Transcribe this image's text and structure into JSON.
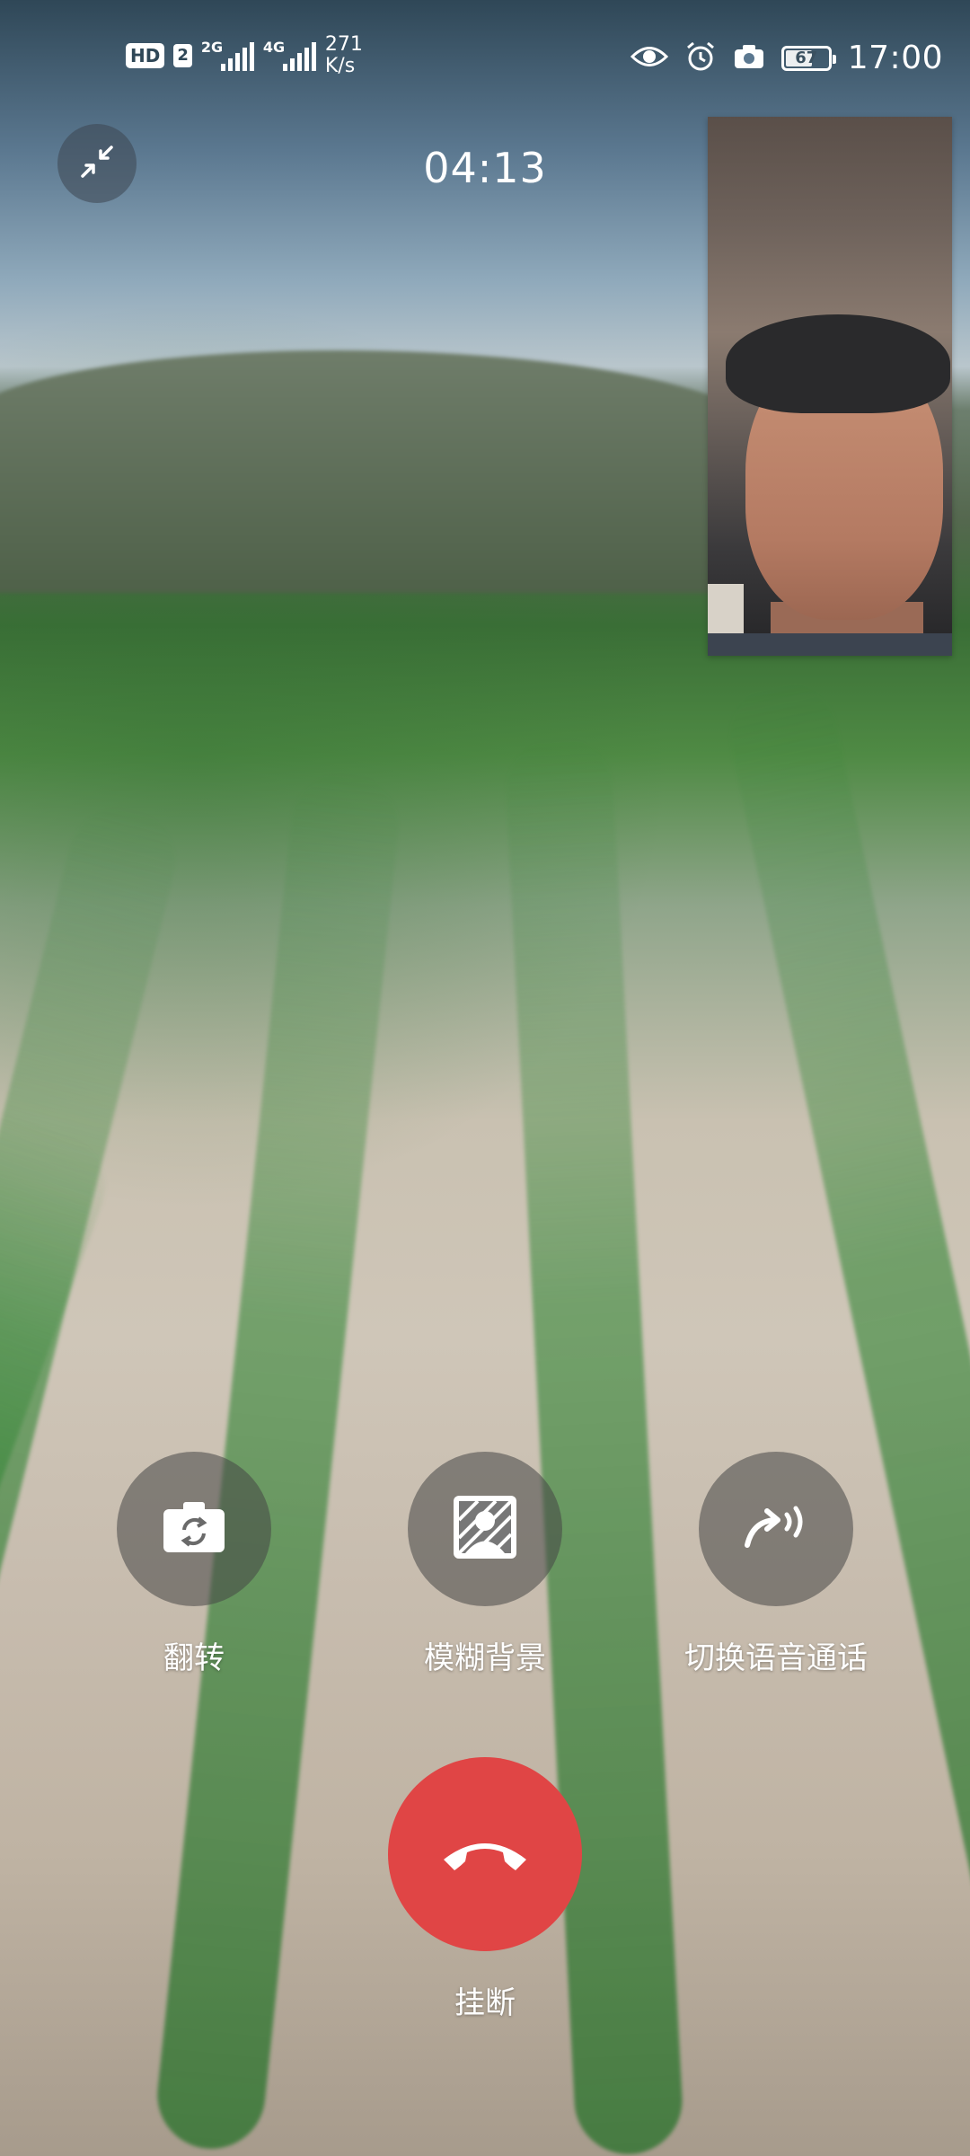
{
  "status_bar": {
    "hd_label": "HD",
    "sim_label": "2",
    "signal_1_tag": "2G",
    "signal_2_tag": "4G",
    "net_speed_value": "271",
    "net_speed_unit": "K/s",
    "icons": [
      "eye-icon",
      "alarm-icon",
      "camera-icon"
    ],
    "battery_level": "67",
    "battery_fraction": 0.67,
    "time": "17:00"
  },
  "call": {
    "duration": "04:13",
    "minimize_icon": "collapse-arrows-icon"
  },
  "controls": {
    "flip": {
      "label": "翻转",
      "icon": "camera-flip-icon"
    },
    "blur_background": {
      "label": "模糊背景",
      "icon": "portrait-blur-icon"
    },
    "switch_voice": {
      "label": "切换语音通话",
      "icon": "switch-to-voice-icon"
    }
  },
  "hangup": {
    "label": "挂断",
    "icon": "phone-hangup-icon",
    "color": "#e04545"
  }
}
